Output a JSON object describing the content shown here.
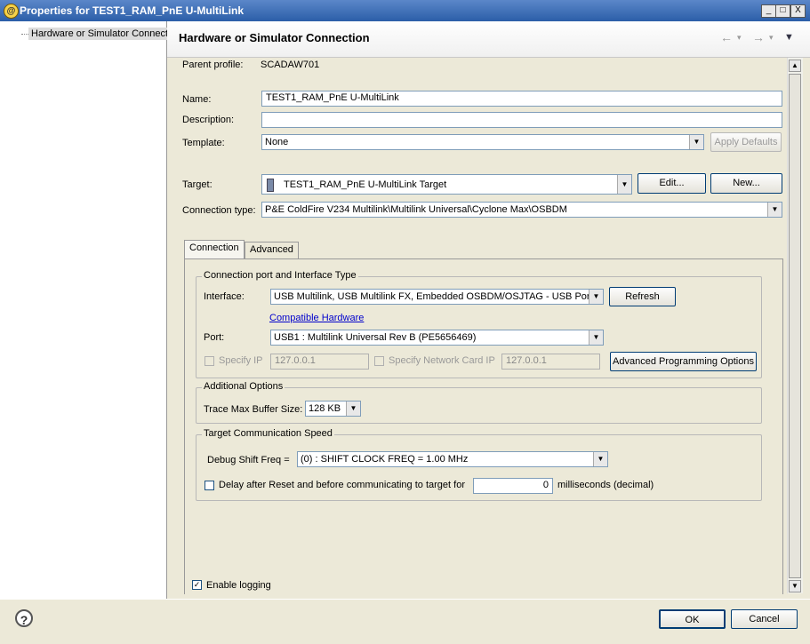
{
  "window": {
    "title": "Properties for TEST1_RAM_PnE U-MultiLink",
    "minimize_glyph": "_",
    "maximize_glyph": "□",
    "close_glyph": "X"
  },
  "tree": {
    "items": [
      {
        "label": "Hardware or Simulator Connect"
      }
    ]
  },
  "header": {
    "title": "Hardware or Simulator Connection",
    "back_icon": "←",
    "forward_icon": "→",
    "menu_icon": "▾"
  },
  "form": {
    "parent_profile_label": "Parent profile:",
    "parent_profile_value": "SCADAW701",
    "name_label": "Name:",
    "name_value": "TEST1_RAM_PnE U-MultiLink",
    "description_label": "Description:",
    "description_value": "",
    "template_label": "Template:",
    "template_value": "None",
    "apply_defaults_label": "Apply Defaults",
    "target_label": "Target:",
    "target_value": "TEST1_RAM_PnE U-MultiLink Target",
    "edit_label": "Edit...",
    "new_label": "New...",
    "connection_type_label": "Connection type:",
    "connection_type_value": "P&E ColdFire V234 Multilink\\Multilink Universal\\Cyclone Max\\OSBDM"
  },
  "tabs": [
    {
      "label": "Connection",
      "active": true
    },
    {
      "label": "Advanced",
      "active": false
    }
  ],
  "connection_port": {
    "group_title": "Connection port and Interface Type",
    "interface_label": "Interface:",
    "interface_value": "USB Multilink, USB Multilink FX, Embedded OSBDM/OSJTAG - USB Port",
    "refresh_label": "Refresh",
    "compatible_hardware_label": "Compatible Hardware",
    "port_label": "Port:",
    "port_value": "USB1 : Multilink Universal Rev B (PE5656469)",
    "specify_ip_label": "Specify IP",
    "ip_value": "127.0.0.1",
    "specify_network_card_ip_label": "Specify Network Card IP",
    "network_card_ip_value": "127.0.0.1",
    "advanced_programming_label": "Advanced Programming Options"
  },
  "additional_options": {
    "group_title": "Additional Options",
    "trace_label": "Trace Max Buffer Size:",
    "trace_value": "128 KB"
  },
  "speed": {
    "group_title": "Target Communication Speed",
    "debug_shift_label": "Debug Shift Freq =",
    "debug_shift_value": "(0) : SHIFT CLOCK FREQ = 1.00 MHz",
    "delay_label": "Delay after Reset and before communicating to target for",
    "delay_value": "0",
    "delay_unit": "milliseconds (decimal)"
  },
  "logging": {
    "enable_label": "Enable logging",
    "checked": true,
    "check_glyph": "✓"
  },
  "footer": {
    "help_glyph": "?",
    "ok_label": "OK",
    "cancel_label": "Cancel"
  },
  "glyphs": {
    "dropdown": "▼",
    "scroll_up": "▲",
    "scroll_down": "▼"
  }
}
